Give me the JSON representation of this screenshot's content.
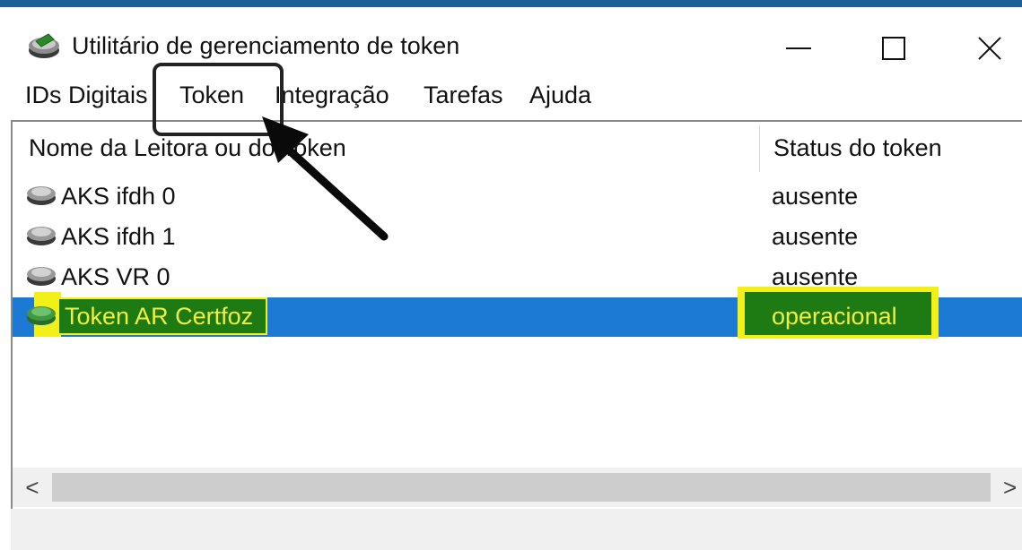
{
  "window": {
    "title": "Utilitário de gerenciamento de token",
    "icon": "token-reader-icon",
    "accent_color": "#1f5f98"
  },
  "menu": {
    "items": [
      "IDs Digitais",
      "Token",
      "Integração",
      "Tarefas",
      "Ajuda"
    ]
  },
  "list": {
    "columns": [
      "Nome da Leitora ou do Token",
      "Status do token"
    ],
    "rows": [
      {
        "name": "AKS ifdh 0",
        "status": "ausente",
        "icon": "card-reader-icon",
        "selected": false
      },
      {
        "name": "AKS ifdh 1",
        "status": "ausente",
        "icon": "card-reader-icon",
        "selected": false
      },
      {
        "name": "AKS VR 0",
        "status": "ausente",
        "icon": "card-reader-icon",
        "selected": false
      },
      {
        "name": "Token AR Certfoz",
        "status": "operacional",
        "icon": "token-active-icon",
        "selected": true
      }
    ],
    "selection_color": "#1c7ad4",
    "highlight_color": "#f3f019"
  },
  "scrollbar": {
    "left_arrow": "<",
    "right_arrow": ">"
  }
}
